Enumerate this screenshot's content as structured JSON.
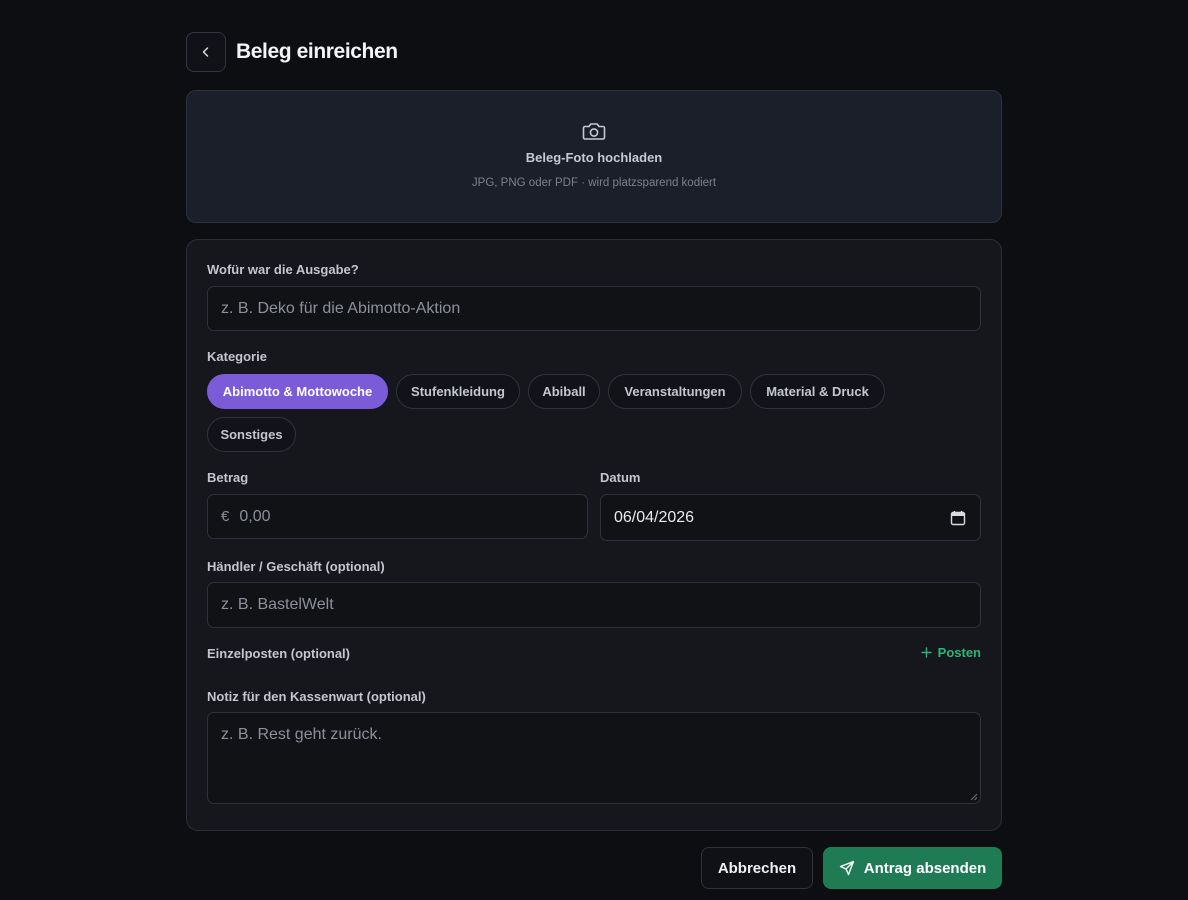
{
  "header": {
    "title": "Beleg einreichen",
    "back_icon": "chevron-left-icon"
  },
  "upload": {
    "icon": "camera-icon",
    "title": "Beleg-Foto hochladen",
    "hint": "JPG, PNG oder PDF · wird platzsparend kodiert"
  },
  "form": {
    "purpose": {
      "label": "Wofür war die Ausgabe?",
      "placeholder": "z. B. Deko für die Abimotto-Aktion"
    },
    "category": {
      "label": "Kategorie",
      "selected": "Abimotto & Mottowoche",
      "options": [
        "Abimotto & Mottowoche",
        "Stufenkleidung",
        "Abiball",
        "Veranstaltungen",
        "Material & Druck",
        "Sonstiges"
      ]
    },
    "amount": {
      "label": "Betrag",
      "currency": "€",
      "placeholder": "0,00"
    },
    "date": {
      "label": "Datum",
      "value": "06/04/2026"
    },
    "merchant": {
      "label": "Händler / Geschäft (optional)",
      "placeholder": "z. B. BastelWelt"
    },
    "items": {
      "label": "Einzelposten (optional)",
      "add_label": "Posten"
    },
    "note": {
      "label": "Notiz für den Kassenwart (optional)",
      "placeholder": "z. B. Rest geht zurück."
    }
  },
  "actions": {
    "cancel_label": "Abbrechen",
    "submit_label": "Antrag absenden",
    "submit_icon": "send-icon"
  },
  "colors": {
    "background": "#0d0e12",
    "accent_purple": "#7b5bd8",
    "accent_green": "#1e7b54",
    "posten_green": "#2bb673"
  }
}
